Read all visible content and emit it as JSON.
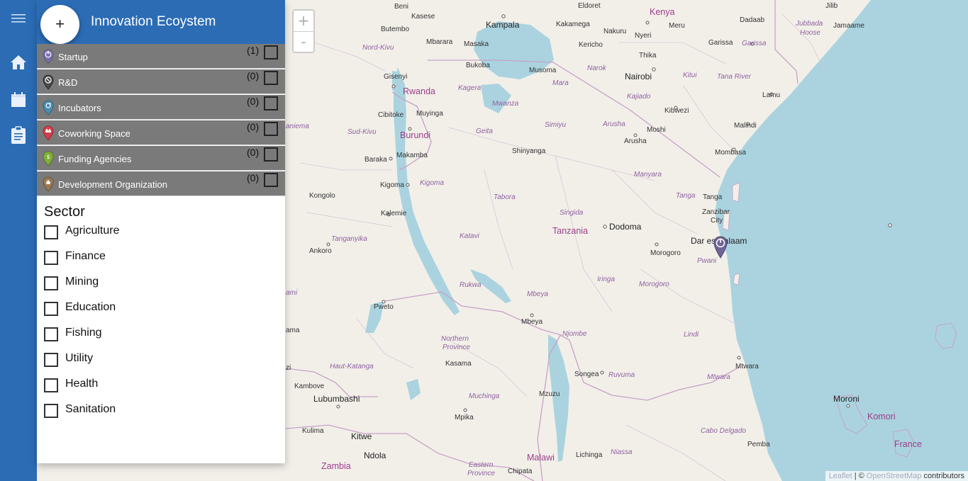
{
  "app": {
    "title": "Innovation Ecoystem",
    "add_symbol": "+"
  },
  "rail": {
    "items": [
      "menu-icon",
      "home-icon",
      "calendar-icon",
      "clipboard-icon"
    ]
  },
  "categories": [
    {
      "label": "Startup",
      "count": "(1)",
      "color": "#7b6bb0"
    },
    {
      "label": "R&D",
      "count": "(0)",
      "color": "#4a4a4a"
    },
    {
      "label": "Incubators",
      "count": "(0)",
      "color": "#4a8fb0"
    },
    {
      "label": "Coworking Space",
      "count": "(0)",
      "color": "#d13f4a"
    },
    {
      "label": "Funding Agencies",
      "count": "(0)",
      "color": "#7fae3a"
    },
    {
      "label": "Development Organization",
      "count": "(0)",
      "color": "#9a7a55"
    }
  ],
  "sector": {
    "title": "Sector",
    "items": [
      "Agriculture",
      "Finance",
      "Mining",
      "Education",
      "Fishing",
      "Utility",
      "Health",
      "Sanitation"
    ]
  },
  "map": {
    "zoom_in": "+",
    "zoom_out": "-",
    "attribution": {
      "leaflet": "Leaflet",
      "sep": "| ©",
      "osm": "OpenStreetMap",
      "suffix": "contributors"
    },
    "marker_color": "#6f6496",
    "colors": {
      "land": "#f2efe9",
      "water": "#aad3df",
      "border": "#c7a2c7"
    },
    "labels": {
      "beni": "Beni",
      "kasese": "Kasese",
      "kampala": "Kampala",
      "kakamega": "Kakamega",
      "eldoret": "Eldoret",
      "kenya": "Kenya",
      "jilib": "Jilib",
      "butembo": "Butembo",
      "mbarara": "Mbarara",
      "masaka": "Masaka",
      "nakuru": "Nakuru",
      "nyeri": "Nyeri",
      "meru": "Meru",
      "dadaab": "Dadaab",
      "jubbada_hoose_1": "Jubbada",
      "jubbada_hoose_2": "Hoose",
      "jamaame": "Jamaame",
      "nord_kivu": "Nord-Kivu",
      "kericho": "Kericho",
      "thika": "Thika",
      "garissa_city": "Garissa",
      "garissa_region": "Garissa",
      "bukoba": "Bukoba",
      "musoma": "Musoma",
      "narok": "Narok",
      "nairobi": "Nairobi",
      "kitui": "Kitui",
      "tana_river": "Tana River",
      "gisenyi": "Gisenyi",
      "rwanda": "Rwanda",
      "kagera": "Kagera",
      "mara": "Mara",
      "kajiado": "Kajiado",
      "lamu": "Lamu",
      "mwanza": "Mwanza",
      "kibwezi": "Kibwezi",
      "sud_kivu": "Sud-Kivu",
      "cibitoke": "Cibitoke",
      "muyinga": "Muyinga",
      "geita": "Geita",
      "simiyu": "Simiyu",
      "arusha_region": "Arusha",
      "moshi": "Moshi",
      "malindi": "Malindi",
      "burundi": "Burundi",
      "arusha_city": "Arusha",
      "shinyanga": "Shinyanga",
      "baraka": "Baraka",
      "makamba": "Makamba",
      "mombasa": "Mombasa",
      "manyara": "Manyara",
      "kigoma_city": "Kigoma",
      "kigoma_region": "Kigoma",
      "tanga_region": "Tanga",
      "tanga_city": "Tanga",
      "kongolo": "Kongolo",
      "tabora": "Tabora",
      "zanzibar_1": "Zanzibar",
      "zanzibar_2": "City",
      "kalemie": "Kalemie",
      "singida": "Singida",
      "tanzania": "Tanzania",
      "dodoma": "Dodoma",
      "tanganyika": "Tanganyika",
      "katavi": "Katavi",
      "dar_es_salaam": "Dar es Salaam",
      "ankoro": "Ankoro",
      "morogoro_city": "Morogoro",
      "pwani": "Pwani",
      "iringa": "Iringa",
      "rukwa": "Rukwa",
      "mbeya_region": "Mbeya",
      "morogoro_region": "Morogoro",
      "pweto": "Pweto",
      "mbeya_city": "Mbeya",
      "njombe": "Njombe",
      "lindi": "Lindi",
      "northern_province_1": "Northern",
      "northern_province_2": "Province",
      "haut_katanga": "Haut-Katanga",
      "kasama": "Kasama",
      "mtwara_city": "Mtwara",
      "kambove": "Kambove",
      "songea": "Songea",
      "ruvuma": "Ruvuma",
      "mtwara_region": "Mtwara",
      "lubumbashi": "Lubumbashi",
      "muchinga": "Muchinga",
      "mzuzu": "Mzuzu",
      "moroni": "Moroni",
      "komori": "Komori",
      "mpika": "Mpika",
      "kulima": "Kulima",
      "cabo_delgado": "Cabo Delgado",
      "kitwe": "Kitwe",
      "ndola": "Ndola",
      "pemba": "Pemba",
      "france": "France",
      "malawi": "Malawi",
      "niassa": "Niassa",
      "lichinga": "Lichinga",
      "zambia": "Zambia",
      "eastern_1": "Eastern",
      "eastern_2": "Province",
      "chipata": "Chipata",
      "edge_niema": "aniema",
      "edge_ami": "ami",
      "edge_ama": "ama",
      "edge_zi": "zi"
    }
  }
}
